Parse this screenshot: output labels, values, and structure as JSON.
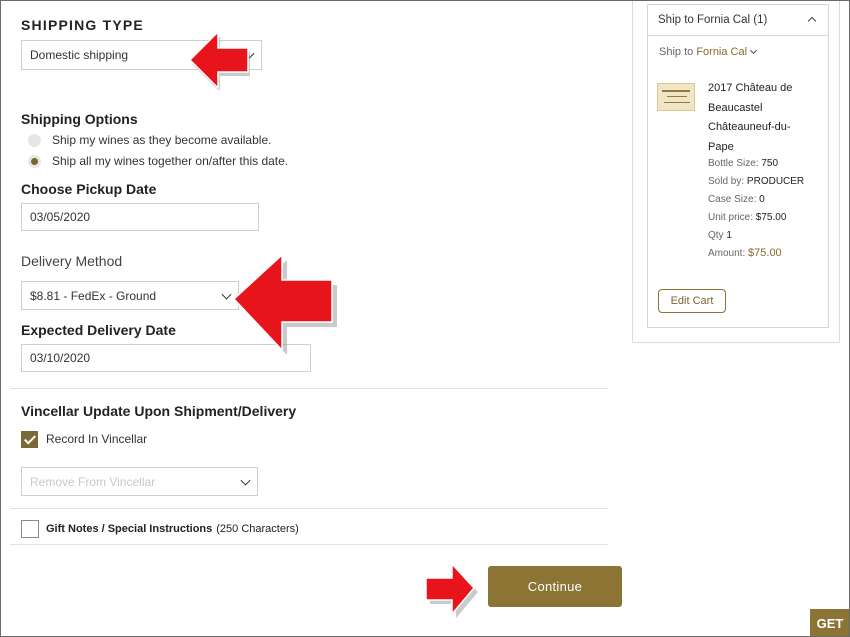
{
  "shipping_type": {
    "heading": "SHIPPING TYPE",
    "selected": "Domestic shipping"
  },
  "shipping_options": {
    "heading": "Shipping Options",
    "options": [
      {
        "label": "Ship my wines as they become available.",
        "checked": false
      },
      {
        "label": "Ship all my wines together on/after this date.",
        "checked": true
      }
    ]
  },
  "pickup": {
    "heading": "Choose Pickup Date",
    "value": "03/05/2020"
  },
  "delivery_method": {
    "heading": "Delivery Method",
    "selected": "$8.81 - FedEx - Ground"
  },
  "expected_delivery": {
    "heading": "Expected Delivery Date",
    "value": "03/10/2020"
  },
  "vincellar": {
    "heading": "Vincellar Update Upon Shipment/Delivery",
    "record_label": "Record In Vincellar",
    "record_checked": true,
    "remove_select": "Remove From Vincellar"
  },
  "gift_notes": {
    "label": "Gift Notes / Special Instructions",
    "suffix": "(250 Characters)",
    "checked": false
  },
  "buttons": {
    "continue": "Continue",
    "get": "GET"
  },
  "sidebar": {
    "header": "Ship to Fornia Cal (1)",
    "ship_to_prefix": "Ship to",
    "ship_to_name": "Fornia Cal",
    "item": {
      "name_lines": [
        "2017 Château de",
        "Beaucastel",
        "Châteauneuf-du-",
        "Pape"
      ],
      "bottle_size_label": "Bottle Size:",
      "bottle_size": "750",
      "sold_by_label": "Sold by:",
      "sold_by": "PRODUCER",
      "case_size_label": "Case Size:",
      "case_size": "0",
      "unit_price_label": "Unit price:",
      "unit_price": "$75.00",
      "qty_label": "Qty",
      "qty": "1",
      "amount_label": "Amount:",
      "amount": "$75.00"
    },
    "edit_cart": "Edit Cart"
  },
  "colors": {
    "accent_gold": "#8b7434",
    "arrow_red": "#e8141c",
    "link_gold": "#8b6a2a"
  }
}
